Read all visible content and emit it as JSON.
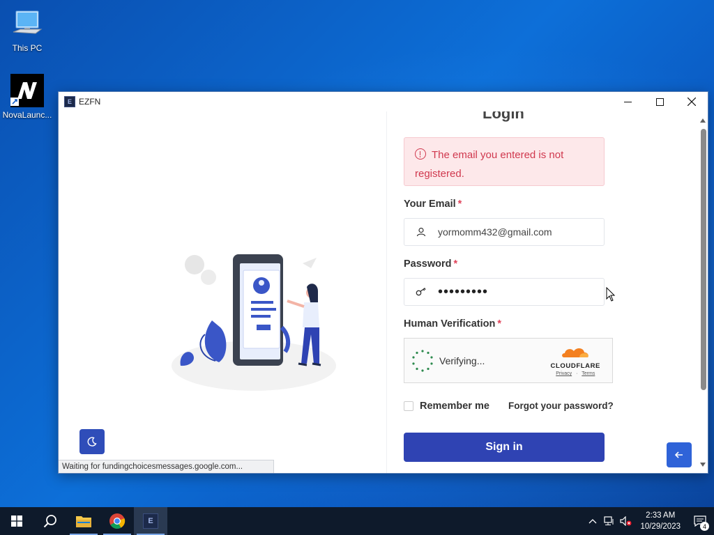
{
  "desktop": {
    "icons": [
      {
        "label": "This PC"
      },
      {
        "label": "NovaLaunc..."
      }
    ]
  },
  "window": {
    "title": "EZFN",
    "app_icon_letter": "E",
    "controls": {
      "minimize": "—",
      "maximize": "☐",
      "close": "✕"
    }
  },
  "login": {
    "heading_partial": "Login",
    "alert": {
      "message": "The email you entered is not registered.",
      "color": "#d0384e"
    },
    "email": {
      "label": "Your Email",
      "required": "*",
      "value": "yormomm432@gmail.com"
    },
    "password": {
      "label": "Password",
      "required": "*",
      "value": "•••••••••"
    },
    "verification": {
      "label": "Human Verification",
      "required": "*",
      "status": "Verifying...",
      "brand": "CLOUDFLARE",
      "privacy": "Privacy",
      "separator": "·",
      "terms": "Terms"
    },
    "remember_label": "Remember me",
    "forgot_label": "Forgot your password?",
    "signin_label": "Sign in",
    "accent_color": "#2f43b3"
  },
  "status_bar": {
    "text": "Waiting for fundingchoicesmessages.google.com..."
  },
  "taskbar": {
    "apps": [
      "start-icon",
      "search-icon",
      "file-explorer-icon",
      "chrome-icon",
      "ezfn-icon"
    ],
    "clock": {
      "time": "2:33 AM",
      "date": "10/29/2023"
    },
    "notification_count": "4"
  }
}
